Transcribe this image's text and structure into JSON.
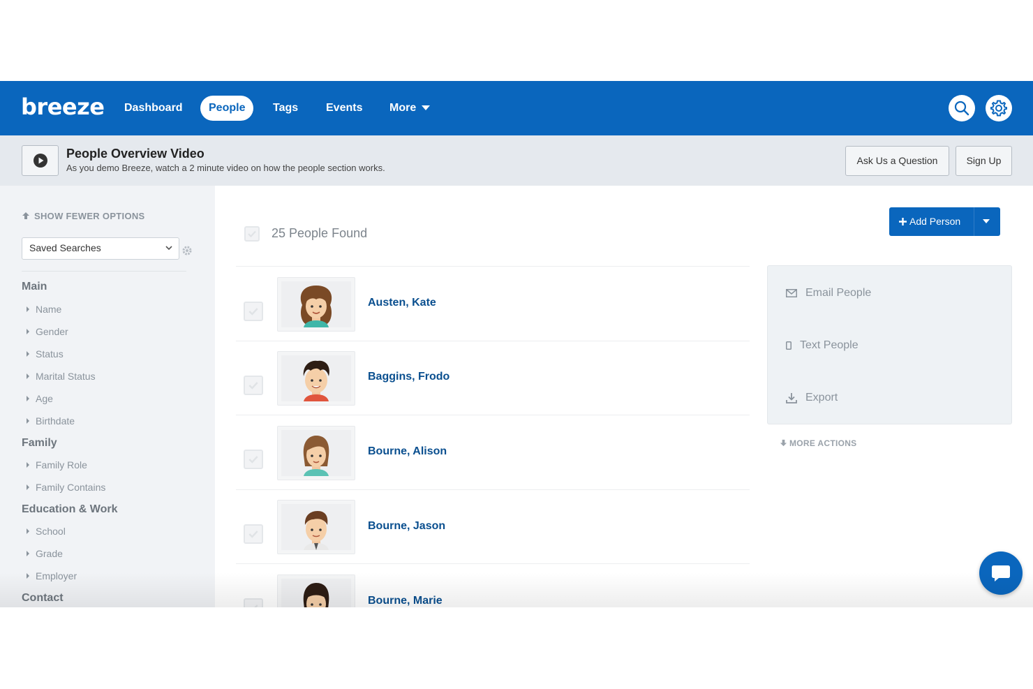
{
  "colors": {
    "brand": "#0a66bd",
    "link": "#0a4f8f"
  },
  "nav": {
    "logo": "breeze",
    "items": [
      {
        "label": "Dashboard",
        "active": false
      },
      {
        "label": "People",
        "active": true
      },
      {
        "label": "Tags",
        "active": false
      },
      {
        "label": "Events",
        "active": false
      },
      {
        "label": "More",
        "active": false
      }
    ],
    "icons": [
      "search-icon",
      "gear-icon"
    ]
  },
  "banner": {
    "title": "People Overview Video",
    "subtitle": "As you demo Breeze, watch a 2 minute video on how the people section works.",
    "ask_label": "Ask Us a Question",
    "signup_label": "Sign Up"
  },
  "sidebar": {
    "toggle_label": "SHOW FEWER OPTIONS",
    "saved_searches": "Saved Searches",
    "groups": [
      {
        "heading": "Main",
        "items": [
          "Name",
          "Gender",
          "Status",
          "Marital Status",
          "Age",
          "Birthdate"
        ]
      },
      {
        "heading": "Family",
        "items": [
          "Family Role",
          "Family Contains"
        ]
      },
      {
        "heading": "Education & Work",
        "items": [
          "School",
          "Grade",
          "Employer"
        ]
      },
      {
        "heading": "Contact",
        "items": []
      }
    ]
  },
  "main": {
    "found_label": "25 People Found",
    "add_person_label": "Add Person",
    "people": [
      {
        "name": "Austen, Kate"
      },
      {
        "name": "Baggins, Frodo"
      },
      {
        "name": "Bourne, Alison"
      },
      {
        "name": "Bourne, Jason"
      },
      {
        "name": "Bourne, Marie"
      }
    ],
    "actions": [
      "Email People",
      "Text People",
      "Export"
    ],
    "more_actions_label": "MORE ACTIONS"
  }
}
